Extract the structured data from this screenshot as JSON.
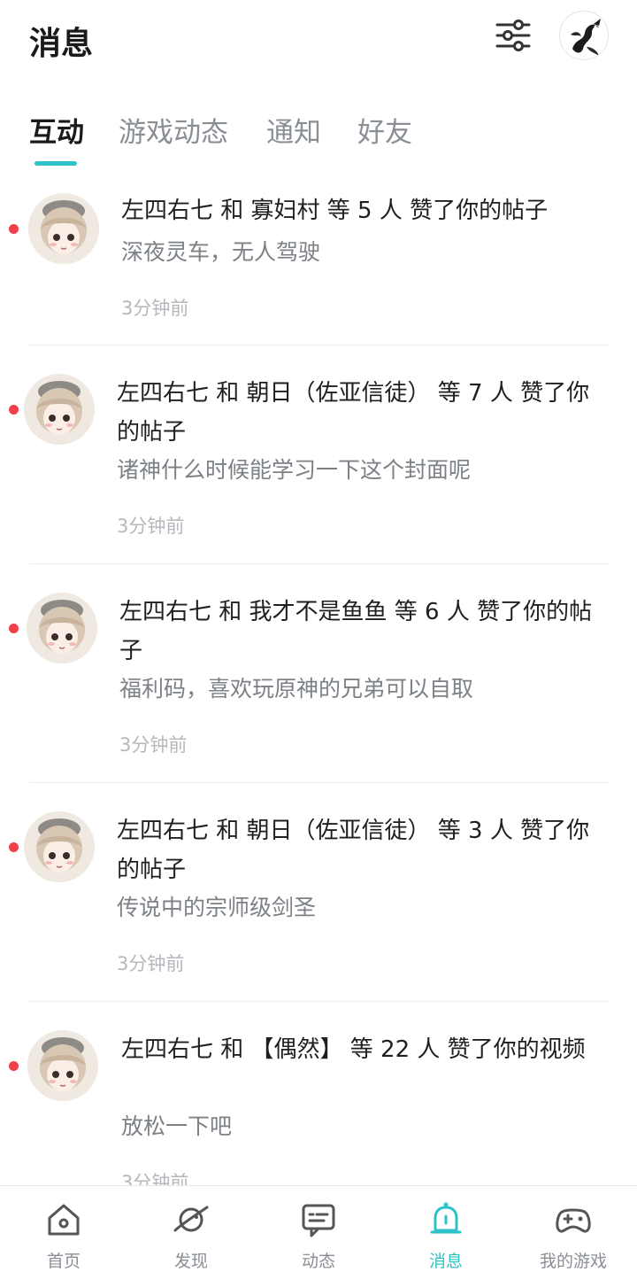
{
  "header": {
    "title": "消息",
    "filter_icon": "filter-sliders-icon",
    "avatar_icon": "dragon-avatar"
  },
  "tabs": [
    {
      "label": "互动",
      "active": true
    },
    {
      "label": "游戏动态",
      "active": false
    },
    {
      "label": "通知",
      "active": false
    },
    {
      "label": "好友",
      "active": false
    }
  ],
  "items": [
    {
      "title": "左四右七 和 寡妇村 等 5 人 赞了你的帖子",
      "subtitle": "深夜灵车，无人驾驶",
      "time": "3分钟前",
      "unread": true
    },
    {
      "title": "左四右七 和 朝日（佐亚信徒） 等 7 人 赞了你的帖子",
      "subtitle": "诸神什么时候能学习一下这个封面呢",
      "time": "3分钟前",
      "unread": true
    },
    {
      "title": "左四右七 和 我才不是鱼鱼 等 6 人 赞了你的帖子",
      "subtitle": "福利码，喜欢玩原神的兄弟可以自取",
      "time": "3分钟前",
      "unread": true
    },
    {
      "title": "左四右七 和 朝日（佐亚信徒） 等 3 人 赞了你的帖子",
      "subtitle": "传说中的宗师级剑圣",
      "time": "3分钟前",
      "unread": true
    },
    {
      "title": "左四右七 和 【偶然】 等 22 人 赞了你的视频",
      "subtitle": "放松一下吧",
      "time": "3分钟前",
      "unread": true
    }
  ],
  "nav": [
    {
      "label": "首页",
      "icon": "home-icon",
      "active": false
    },
    {
      "label": "发现",
      "icon": "planet-icon",
      "active": false
    },
    {
      "label": "动态",
      "icon": "message-box-icon",
      "active": false
    },
    {
      "label": "消息",
      "icon": "bell-icon",
      "active": true
    },
    {
      "label": "我的游戏",
      "icon": "gamepad-icon",
      "active": false
    }
  ],
  "colors": {
    "accent": "#2cc3c8",
    "unread_dot": "#f0404a",
    "text_primary": "#1f1f1f",
    "text_secondary": "#7c8187",
    "text_muted": "#b4b8bc"
  }
}
